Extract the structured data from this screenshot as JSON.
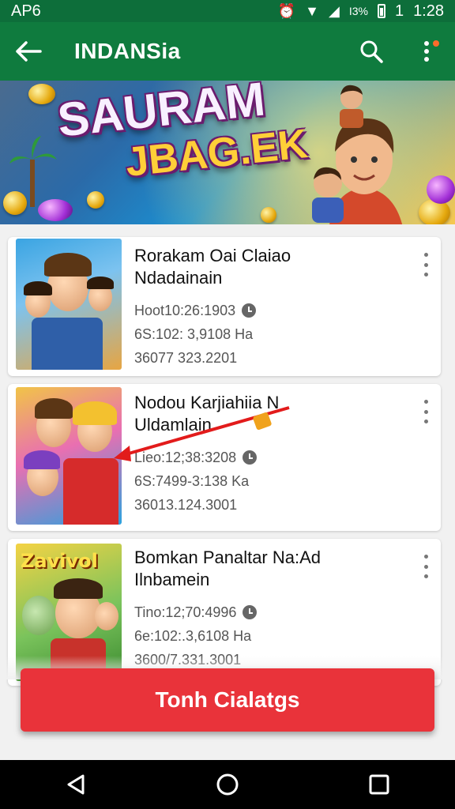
{
  "status_bar": {
    "left_text": "AP6",
    "carrier_text": "I3%",
    "signal_text": "1",
    "time": "1:28"
  },
  "app_bar": {
    "title": "INDANSia"
  },
  "banner": {
    "title_line1": "SAURAM",
    "title_line2": "JBAG.EK"
  },
  "items": [
    {
      "title_line1": "Rorakam Oai Claiao",
      "title_line2": "Ndadainain",
      "meta1": "Hoot10:26:1903",
      "meta2": "6S:102: 3,9108 Ha",
      "meta3": "36077 323.2201"
    },
    {
      "title_line1": "Nodou Karjiahiia N",
      "title_line2": "Uldamlain",
      "meta1": "Lieo:12;38:3208",
      "meta2": "6S:7499-3:138 Ka",
      "meta3": "36013.124.3001"
    },
    {
      "title_line1": "Bomkan Panaltar Na:Ad",
      "title_line2": "Ilnbamein",
      "meta1": "Tino:12;70:4996",
      "meta2": "6e:102:.3,6108 Ha",
      "meta3": "3600/7.331.3001",
      "thumb_text": "Zavivol"
    }
  ],
  "action_button": {
    "label": "Tonh Cialatgs"
  },
  "colors": {
    "status_bar": "#0d6e3a",
    "app_bar": "#0f7b3e",
    "action_button": "#e9333a",
    "nav_bar": "#000000"
  },
  "icons": {
    "back": "arrow-left",
    "search": "magnifier",
    "more": "vertical-dots",
    "clock": "clock",
    "nav_back": "triangle-left",
    "nav_home": "circle",
    "nav_recents": "square"
  }
}
